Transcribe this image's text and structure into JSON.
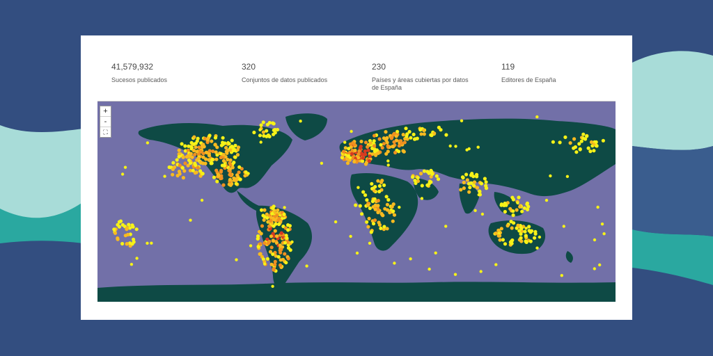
{
  "stats": [
    {
      "value": "41,579,932",
      "label": "Sucesos publicados"
    },
    {
      "value": "320",
      "label": "Conjuntos de datos publicados"
    },
    {
      "value": "230",
      "label": "Países y áreas cubiertas por datos de España"
    },
    {
      "value": "119",
      "label": "Editores de España"
    }
  ],
  "map": {
    "zoom_in_label": "+",
    "zoom_out_label": "-",
    "fullscreen_label": "⛶",
    "colors": {
      "ocean": "#7270a8",
      "land": "#0e4a45",
      "density_low": "#f6f218",
      "density_mid": "#f8ba20",
      "density_high": "#f09020",
      "density_max": "#d83a20"
    }
  },
  "background": {
    "navy": "#334e80",
    "teal": "#2aa8a0",
    "mint": "#a8dcd8"
  }
}
